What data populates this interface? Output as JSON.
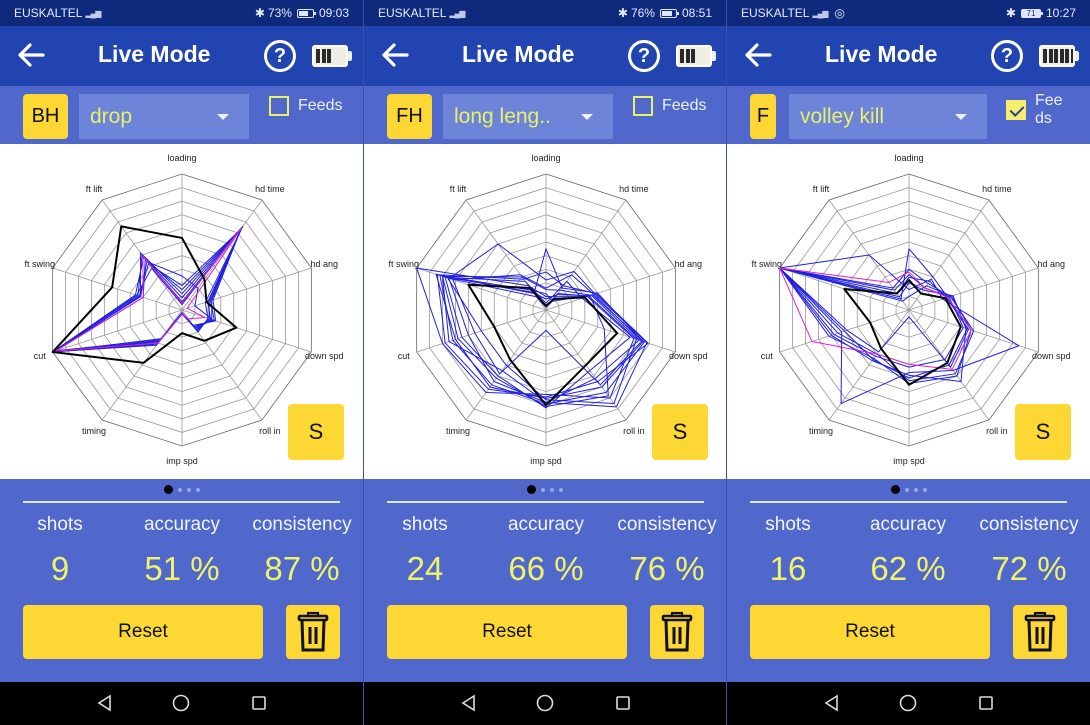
{
  "screens": [
    {
      "status": {
        "carrier": "EUSKALTEL",
        "network": "4G",
        "battery_text": "73%",
        "time": "09:03",
        "extra_icon": ""
      },
      "appbar": {
        "title": "Live Mode",
        "back_icon": "arrow-left-icon",
        "help_label": "?",
        "device_battery_cells": 3
      },
      "toolbar": {
        "hand": "BH",
        "shot": "drop",
        "feeds_label": "Feeds",
        "feeds_checked": false
      },
      "chart_button": "S",
      "pager": {
        "count": 4,
        "active": 0
      },
      "stats": {
        "shots_label": "shots",
        "shots": "9",
        "accuracy_label": "accuracy",
        "accuracy": "51 %",
        "consistency_label": "consistency",
        "consistency": "87 %"
      },
      "reset_label": "Reset"
    },
    {
      "status": {
        "carrier": "EUSKALTEL",
        "network": "4G",
        "battery_text": "76%",
        "time": "08:51",
        "extra_icon": ""
      },
      "appbar": {
        "title": "Live Mode",
        "back_icon": "arrow-left-icon",
        "help_label": "?",
        "device_battery_cells": 3
      },
      "toolbar": {
        "hand": "FH",
        "shot": "long leng..",
        "feeds_label": "Feeds",
        "feeds_checked": false
      },
      "chart_button": "S",
      "pager": {
        "count": 4,
        "active": 0
      },
      "stats": {
        "shots_label": "shots",
        "shots": "24",
        "accuracy_label": "accuracy",
        "accuracy": "66 %",
        "consistency_label": "consistency",
        "consistency": "76 %"
      },
      "reset_label": "Reset"
    },
    {
      "status": {
        "carrier": "EUSKALTEL",
        "network": "4G",
        "battery_text": "71",
        "time": "10:27",
        "extra_icon": "instagram-icon"
      },
      "appbar": {
        "title": "Live Mode",
        "back_icon": "arrow-left-icon",
        "help_label": "?",
        "device_battery_cells": 6
      },
      "toolbar": {
        "hand": "F",
        "shot": "volley kill",
        "feeds_label": "Feeds",
        "feeds_checked": true
      },
      "chart_button": "S",
      "pager": {
        "count": 4,
        "active": 0
      },
      "stats": {
        "shots_label": "shots",
        "shots": "16",
        "accuracy_label": "accuracy",
        "accuracy": "62 %",
        "consistency_label": "consistency",
        "consistency": "72 %"
      },
      "reset_label": "Reset"
    }
  ],
  "colors": {
    "reference": "#000000",
    "shot": "#2020e0",
    "latest": "#e020d0",
    "accent": "#fdd835",
    "value": "#eef36a"
  },
  "chart_data": [
    {
      "type": "radar",
      "axes": [
        "loading",
        "hd time",
        "hd ang",
        "down spd",
        "roll in",
        "imp spd",
        "timing",
        "cut",
        "ft swing",
        "ft lift"
      ],
      "range": [
        0,
        10
      ],
      "rings": 10,
      "series": [
        {
          "name": "reference",
          "values": [
            5.3,
            2.8,
            1.9,
            4.2,
            2.8,
            1.7,
            4.8,
            10,
            5.4,
            7.6
          ]
        },
        {
          "name": "shot",
          "values": [
            1.2,
            7.5,
            2.2,
            2.5,
            1.5,
            0.2,
            2.8,
            10,
            3.2,
            5.2
          ]
        },
        {
          "name": "shot",
          "values": [
            0.9,
            7.5,
            2.0,
            2.2,
            1.8,
            0.2,
            3.0,
            10,
            3.4,
            5.0
          ]
        },
        {
          "name": "shot",
          "values": [
            1.5,
            7.4,
            2.4,
            2.6,
            1.4,
            0.3,
            2.9,
            9.8,
            3.0,
            4.6
          ]
        },
        {
          "name": "shot",
          "values": [
            0.6,
            7.6,
            1.8,
            2.0,
            2.0,
            0.2,
            2.6,
            10,
            3.6,
            4.8
          ]
        },
        {
          "name": "shot",
          "values": [
            2.5,
            2.0,
            1.0,
            2.4,
            1.6,
            0.3,
            3.2,
            9.9,
            3.2,
            4.4
          ]
        },
        {
          "name": "shot",
          "values": [
            1.8,
            7.3,
            2.3,
            2.3,
            1.7,
            0.2,
            2.7,
            9.7,
            3.3,
            4.2
          ]
        },
        {
          "name": "shot",
          "values": [
            0.4,
            7.5,
            2.1,
            2.1,
            1.9,
            0.2,
            3.1,
            10,
            3.5,
            3.8
          ]
        },
        {
          "name": "latest",
          "values": [
            0.5,
            7.4,
            0.4,
            1.8,
            0.8,
            0.3,
            3.0,
            9.8,
            3.0,
            4.9
          ]
        }
      ]
    },
    {
      "type": "radar",
      "axes": [
        "loading",
        "hd time",
        "hd ang",
        "down spd",
        "roll in",
        "imp spd",
        "timing",
        "cut",
        "ft swing",
        "ft lift"
      ],
      "range": [
        0,
        10
      ],
      "rings": 10,
      "series": [
        {
          "name": "reference",
          "values": [
            0.3,
            1.0,
            3.0,
            5.5,
            5.0,
            7.0,
            4.5,
            4.0,
            6.0,
            2.0
          ]
        },
        {
          "name": "shot",
          "values": [
            4.5,
            2.0,
            4.0,
            7.5,
            7.0,
            6.5,
            7.0,
            7.0,
            8.5,
            1.5
          ]
        },
        {
          "name": "shot",
          "values": [
            2.2,
            3.5,
            3.8,
            7.8,
            8.8,
            6.8,
            6.5,
            6.0,
            7.5,
            6.0
          ]
        },
        {
          "name": "shot",
          "values": [
            1.5,
            1.8,
            3.5,
            7.2,
            6.2,
            6.8,
            5.5,
            7.5,
            8.0,
            3.0
          ]
        },
        {
          "name": "shot",
          "values": [
            1.0,
            1.2,
            3.2,
            6.8,
            8.0,
            6.2,
            7.5,
            8.0,
            10,
            2.2
          ]
        },
        {
          "name": "shot",
          "values": [
            0.5,
            2.6,
            2.8,
            6.5,
            5.5,
            7.2,
            6.0,
            6.5,
            7.8,
            2.6
          ]
        },
        {
          "name": "shot",
          "values": [
            1.2,
            0.8,
            3.6,
            7.6,
            7.5,
            6.9,
            6.8,
            7.2,
            8.2,
            1.8
          ]
        },
        {
          "name": "shot",
          "values": [
            0.2,
            1.5,
            3.3,
            7.0,
            8.5,
            6.6,
            5.0,
            5.0,
            7.6,
            1.2
          ]
        },
        {
          "name": "shot",
          "values": [
            2.8,
            2.2,
            3.9,
            7.9,
            6.5,
            6.4,
            7.2,
            7.8,
            8.4,
            2.8
          ]
        },
        {
          "name": "shot",
          "values": [
            0.8,
            1.4,
            3.4,
            4.5,
            7.8,
            7.1,
            6.2,
            6.8,
            8.0,
            1.6
          ]
        },
        {
          "name": "shot",
          "values": [
            1.6,
            3.2,
            3.7,
            7.4,
            6.8,
            1.5,
            5.8,
            5.5,
            7.2,
            3.2
          ]
        }
      ]
    },
    {
      "type": "radar",
      "axes": [
        "loading",
        "hd time",
        "hd ang",
        "down spd",
        "roll in",
        "imp spd",
        "timing",
        "cut",
        "ft swing",
        "ft lift"
      ],
      "range": [
        0,
        10
      ],
      "rings": 10,
      "series": [
        {
          "name": "reference",
          "values": [
            2.2,
            1.5,
            2.8,
            4.0,
            4.8,
            5.5,
            3.5,
            3.0,
            5.0,
            1.5
          ]
        },
        {
          "name": "shot",
          "values": [
            4.5,
            3.0,
            3.0,
            4.5,
            5.0,
            5.0,
            4.5,
            5.0,
            10,
            1.0
          ]
        },
        {
          "name": "shot",
          "values": [
            3.0,
            2.4,
            3.2,
            5.0,
            5.8,
            5.2,
            4.0,
            5.5,
            10,
            2.0
          ]
        },
        {
          "name": "shot",
          "values": [
            2.0,
            1.8,
            3.4,
            4.4,
            6.5,
            4.8,
            4.6,
            6.0,
            10,
            1.2
          ]
        },
        {
          "name": "shot",
          "values": [
            1.5,
            2.8,
            2.6,
            8.5,
            5.5,
            4.6,
            8.5,
            5.2,
            10,
            5.0
          ]
        },
        {
          "name": "shot",
          "values": [
            2.6,
            2.0,
            3.1,
            4.2,
            4.5,
            4.2,
            4.2,
            5.8,
            10,
            1.8
          ]
        },
        {
          "name": "shot",
          "values": [
            1.0,
            2.2,
            3.3,
            4.8,
            6.0,
            5.4,
            4.4,
            6.2,
            10,
            0.8
          ]
        },
        {
          "name": "shot",
          "values": [
            2.4,
            2.6,
            2.9,
            4.6,
            5.2,
            0.5,
            3.8,
            4.8,
            10,
            1.5
          ]
        },
        {
          "name": "latest",
          "values": [
            2.8,
            2.0,
            3.0,
            4.8,
            5.4,
            4.0,
            4.0,
            7.5,
            10,
            2.5
          ]
        }
      ]
    }
  ]
}
